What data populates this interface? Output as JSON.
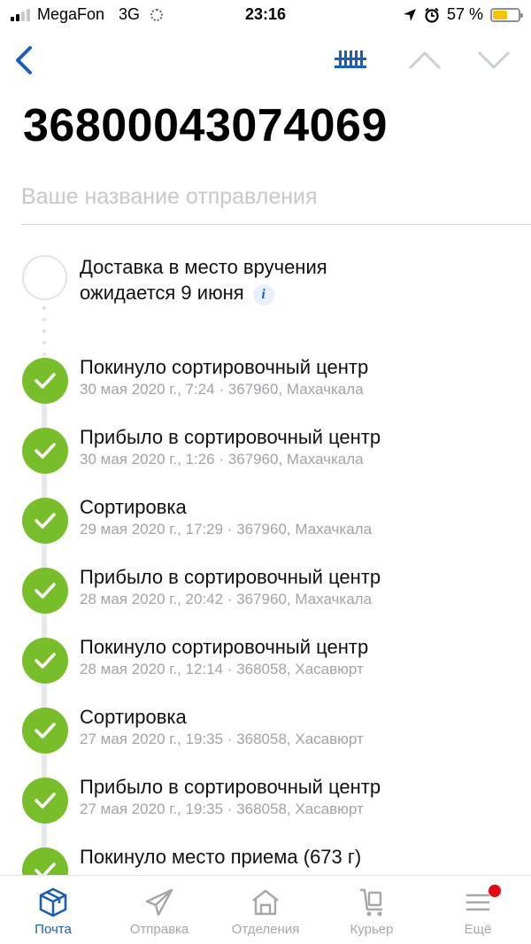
{
  "status_bar": {
    "carrier": "MegaFon",
    "network": "3G",
    "time": "23:16",
    "battery_text": "57 %",
    "battery_level": 0.57
  },
  "shipment": {
    "tracking_number": "36800043074069",
    "name_placeholder": "Ваше название отправления",
    "name_value": ""
  },
  "expected": {
    "line1": "Доставка в место вручения",
    "line2": "ожидается 9 июня",
    "info": "i"
  },
  "events": [
    {
      "title": "Покинуло сортировочный центр",
      "detail": "30 мая 2020 г., 7:24 · 367960, Махачкала"
    },
    {
      "title": "Прибыло в сортировочный центр",
      "detail": "30 мая 2020 г., 1:26 · 367960, Махачкала"
    },
    {
      "title": "Сортировка",
      "detail": "29 мая 2020 г., 17:29 · 367960, Махачкала"
    },
    {
      "title": "Прибыло в сортировочный центр",
      "detail": "28 мая 2020 г., 20:42 · 367960, Махачкала"
    },
    {
      "title": "Покинуло сортировочный центр",
      "detail": "28 мая 2020 г., 12:14 · 368058, Хасавюрт"
    },
    {
      "title": "Сортировка",
      "detail": "27 мая 2020 г., 19:35 · 368058, Хасавюрт"
    },
    {
      "title": "Прибыло в сортировочный центр",
      "detail": "27 мая 2020 г., 19:35 · 368058, Хасавюрт"
    },
    {
      "title": "Покинуло место приема  (673 г)",
      "detail": ""
    }
  ],
  "tabs": [
    {
      "label": "Почта",
      "icon": "box-icon",
      "active": true
    },
    {
      "label": "Отправка",
      "icon": "paper-plane-icon",
      "active": false
    },
    {
      "label": "Отделения",
      "icon": "post-office-icon",
      "active": false
    },
    {
      "label": "Курьер",
      "icon": "courier-cart-icon",
      "active": false
    },
    {
      "label": "Ещё",
      "icon": "menu-icon",
      "active": false,
      "badge": true
    }
  ],
  "colors": {
    "accent": "#1a5fb4",
    "success": "#78be2b",
    "badge": "#e30613",
    "battery": "#f5c400"
  }
}
